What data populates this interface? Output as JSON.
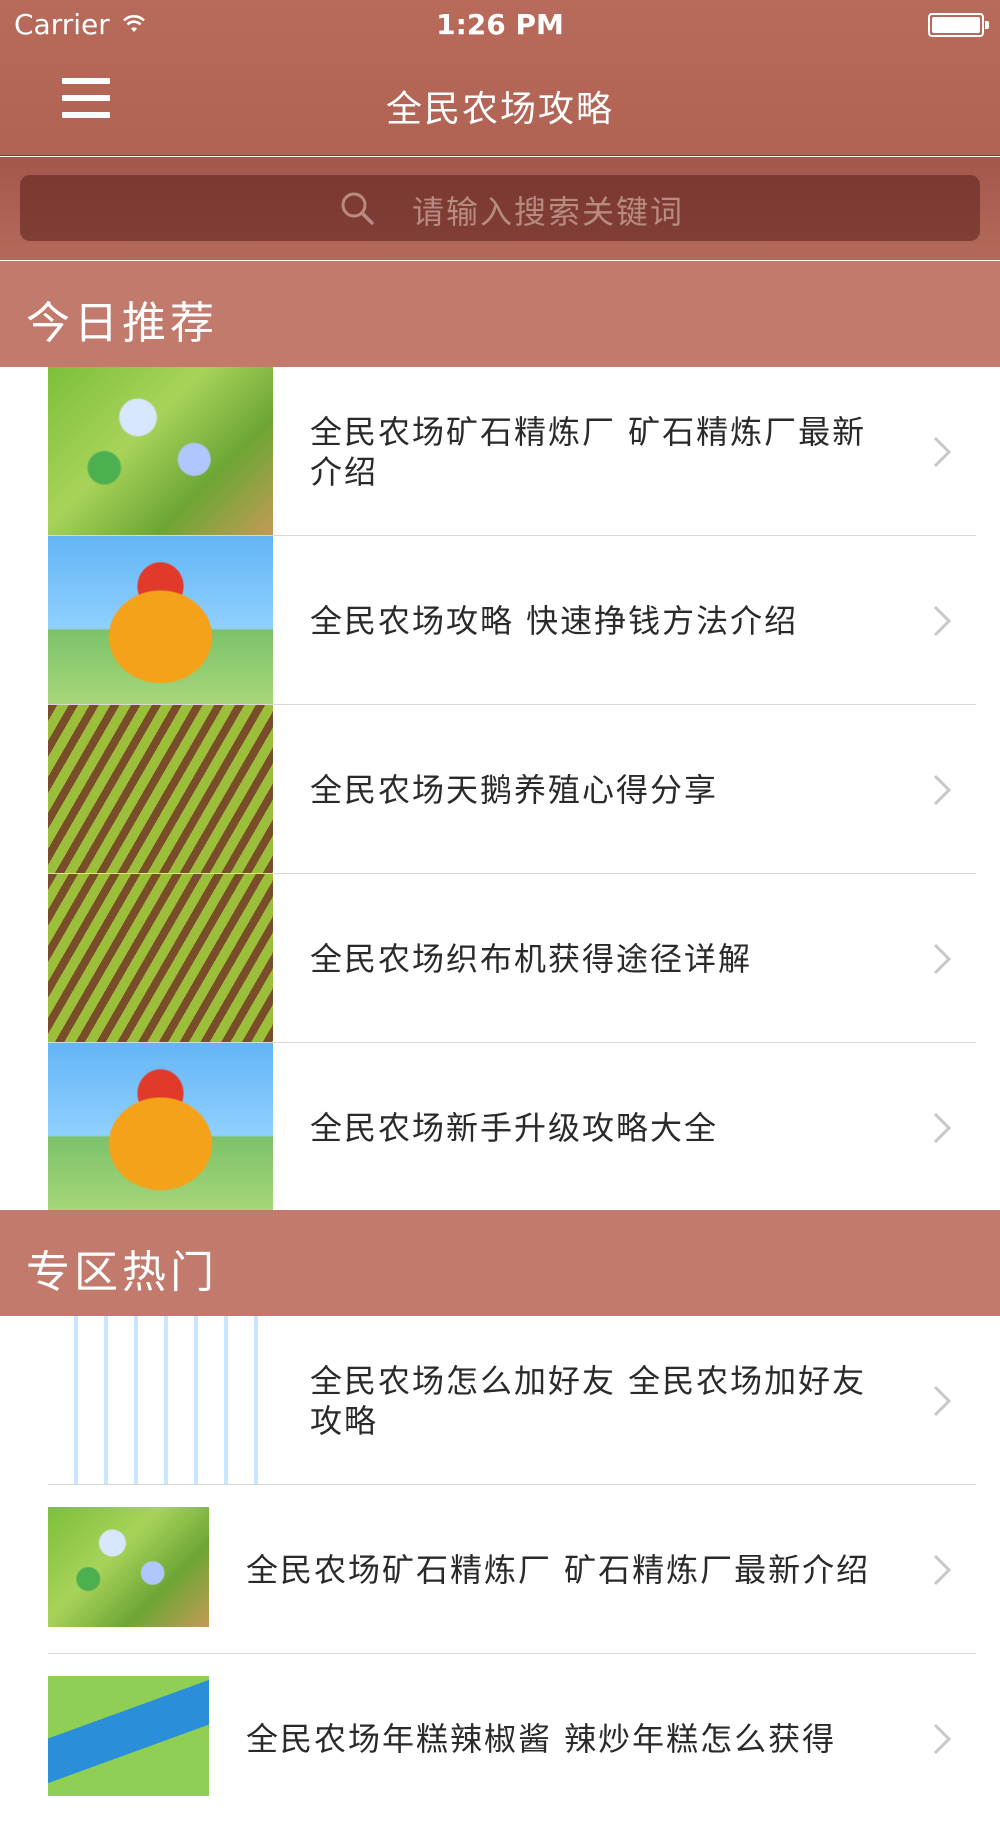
{
  "status_bar": {
    "carrier": "Carrier",
    "time": "1:26 PM"
  },
  "nav": {
    "title": "全民农场攻略"
  },
  "search": {
    "placeholder": "请输入搜索关键词"
  },
  "sections": [
    {
      "title": "今日推荐",
      "items": [
        {
          "title": "全民农场矿石精炼厂 矿石精炼厂最新介绍",
          "thumb": "mine-refinery-thumbnail"
        },
        {
          "title": "全民农场攻略 快速挣钱方法介绍",
          "thumb": "game-logo-thumbnail"
        },
        {
          "title": "全民农场天鹅养殖心得分享",
          "thumb": "farm-field-thumbnail"
        },
        {
          "title": "全民农场织布机获得途径详解",
          "thumb": "farm-field-thumbnail"
        },
        {
          "title": "全民农场新手升级攻略大全",
          "thumb": "game-logo-thumbnail"
        }
      ]
    },
    {
      "title": "专区热门",
      "items": [
        {
          "title": "全民农场怎么加好友 全民农场加好友攻略",
          "thumb": "friends-list-thumbnail"
        },
        {
          "title": "全民农场矿石精炼厂 矿石精炼厂最新介绍",
          "thumb": "mine-refinery-thumbnail"
        },
        {
          "title": "全民农场年糕辣椒酱 辣炒年糕怎么获得",
          "thumb": "river-farm-thumbnail"
        }
      ]
    }
  ]
}
